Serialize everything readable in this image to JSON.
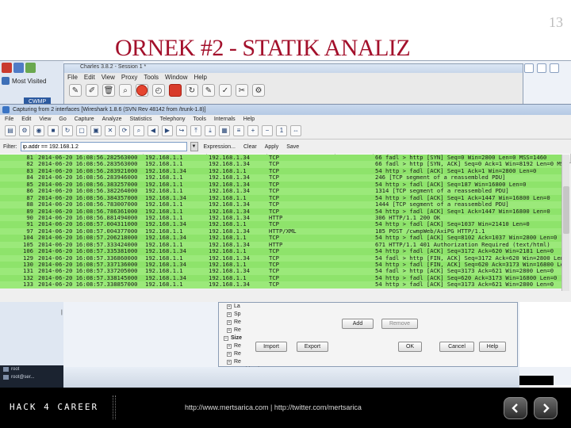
{
  "slide": {
    "number": "13",
    "title": "ORNEK #2 - STATIK ANALIZ"
  },
  "browser": {
    "most_visited": "Most Visited",
    "cwmp_tab": "CWMP"
  },
  "charles": {
    "title": "Charles 3.8.2 - Session 1 *",
    "menu": [
      "File",
      "Edit",
      "View",
      "Proxy",
      "Tools",
      "Window",
      "Help"
    ]
  },
  "wireshark": {
    "title": "Capturing from 2 interfaces   [Wireshark 1.8.6 (SVN Rev 48142 from /trunk-1.8)]",
    "menu": [
      "File",
      "Edit",
      "View",
      "Go",
      "Capture",
      "Analyze",
      "Statistics",
      "Telephony",
      "Tools",
      "Internals",
      "Help"
    ],
    "filter": {
      "label": "Filter:",
      "value": "ip.addr == 192.168.1.2",
      "expression": "Expression...",
      "clear": "Clear",
      "apply": "Apply",
      "save": "Save"
    },
    "columns": [
      "No.",
      "Time",
      "Source",
      "Destination",
      "Protocol",
      "Length",
      "Info"
    ],
    "rows": [
      [
        "81",
        "2014-06-20 16:08:56.282563000",
        "192.168.1.1",
        "192.168.1.34",
        "TCP",
        "",
        "66 fadl > http [SYN] Seq=0 Win=2800 Len=0 MSS=1460"
      ],
      [
        "82",
        "2014-06-20 16:08:56.283563000",
        "192.168.1.1",
        "192.168.1.34",
        "TCP",
        "",
        "66 fadl > http [SYN, ACK] Seq=0 Ack=1 Win=8192 Len=0 MSS=1460"
      ],
      [
        "83",
        "2014-06-20 16:08:56.283921000",
        "192.168.1.34",
        "192.168.1.1",
        "TCP",
        "",
        "54 http > fadl [ACK] Seq=1 Ack=1 Win=2800 Len=0"
      ],
      [
        "84",
        "2014-06-20 16:08:56.283946000",
        "192.168.1.1",
        "192.168.1.34",
        "TCP",
        "",
        "246 [TCP segment of a reassembled PDU]"
      ],
      [
        "85",
        "2014-06-20 16:08:56.383257000",
        "192.168.1.1",
        "192.168.1.34",
        "TCP",
        "",
        "54 http > fadl [ACK] Seq=187 Win=16800 Len=0"
      ],
      [
        "86",
        "2014-06-20 16:08:56.382264000",
        "192.168.1.1",
        "192.168.1.34",
        "TCP",
        "",
        "1314 [TCP segment of a reassembled PDU]"
      ],
      [
        "87",
        "2014-06-20 16:08:56.384357000",
        "192.168.1.34",
        "192.168.1.1",
        "TCP",
        "",
        "54 http > fadl [ACK] Seq=1 Ack=1447 Win=16800 Len=0"
      ],
      [
        "88",
        "2014-06-20 16:08:56.783007000",
        "192.168.1.1",
        "192.168.1.34",
        "TCP",
        "",
        "1444 [TCP segment of a reassembled PDU]"
      ],
      [
        "89",
        "2014-06-20 16:08:56.786361000",
        "192.168.1.1",
        "192.168.1.34",
        "TCP",
        "",
        "54 http > fadl [ACK] Seq=1 Ack=1447 Win=16800 Len=0"
      ],
      [
        "90",
        "2014-06-20 16:08:56.881494000",
        "192.168.1.1",
        "192.168.1.34",
        "HTTP",
        "",
        "306 HTTP/1.1 200 OK"
      ],
      [
        "91",
        "2014-06-20 16:08:57.004311000",
        "192.168.1.34",
        "192.168.1.1",
        "TCP",
        "",
        "54 http > fadl [ACK] Seq=1037 Win=21410 Len=0"
      ],
      [
        "97",
        "2014-06-20 16:08:57.004377000",
        "192.168.1.1",
        "192.168.1.34",
        "HTTP/XML",
        "",
        "185 POST /cwmpWeb/AxiPG HTTP/1.1"
      ],
      [
        "104",
        "2014-06-20 16:08:57.206218000",
        "192.168.1.34",
        "192.168.1.1",
        "TCP",
        "",
        "54 http > fadl [ACK] Seq=8102 Ack=1037 Win=2800 Len=0"
      ],
      [
        "105",
        "2014-06-20 16:08:57.333424000",
        "192.168.1.1",
        "192.168.1.34",
        "HTTP",
        "",
        "671 HTTP/1.1 401 Authorization Required  (text/html)"
      ],
      [
        "106",
        "2014-06-20 16:08:57.335381000",
        "192.168.1.34",
        "192.168.1.1",
        "TCP",
        "",
        "54 http > fadl [ACK] Seq=3172 Ack=620 Win=2181 Len=0"
      ],
      [
        "129",
        "2014-06-20 16:08:57.336860000",
        "192.168.1.1",
        "192.168.1.34",
        "TCP",
        "",
        "54 fadl > http [FIN, ACK] Seq=3172 Ack=620 Win=2800 Len=0"
      ],
      [
        "130",
        "2014-06-20 16:08:57.337136000",
        "192.168.1.34",
        "192.168.1.1",
        "TCP",
        "",
        "54 http > fadl [FIN, ACK] Seq=620 Ack=3173 Win=16800 Len=0"
      ],
      [
        "131",
        "2014-06-20 16:08:57.337205000",
        "192.168.1.1",
        "192.168.1.34",
        "TCP",
        "",
        "54 fadl > http [ACK] Seq=3173 Ack=621 Win=2800 Len=0"
      ],
      [
        "132",
        "2014-06-20 16:08:57.338145000",
        "192.168.1.34",
        "192.168.1.1",
        "TCP",
        "",
        "54 http > fadl [ACK] Seq=620 Ack=3173 Win=16800 Len=0"
      ],
      [
        "133",
        "2014-06-20 16:08:57.338857000",
        "192.168.1.1",
        "192.168.1.34",
        "TCP",
        "",
        "54 http > fadl [ACK] Seq=3173 Ack=621 Win=2800 Len=0"
      ]
    ]
  },
  "dialog": {
    "tree_items": [
      "La",
      "Sp",
      "Re",
      "Re",
      "Size",
      "Re",
      "Re",
      "Re",
      "Combined",
      "Compression"
    ],
    "add_button": "Add",
    "remove_button": "Remove",
    "import_button": "Import",
    "export_button": "Export",
    "ok_button": "OK",
    "cancel_button": "Cancel",
    "help_button": "Help"
  },
  "tray": {
    "line1": "root",
    "line2": "root@ser..."
  },
  "footer": {
    "brand": "HACK 4 CAREER",
    "links": "http://www.mertsarica.com | http://twitter.com/mertsarica"
  },
  "colors": {
    "title": "#a3102b",
    "packet_row": "#8ee36b",
    "footer": "#000000"
  }
}
